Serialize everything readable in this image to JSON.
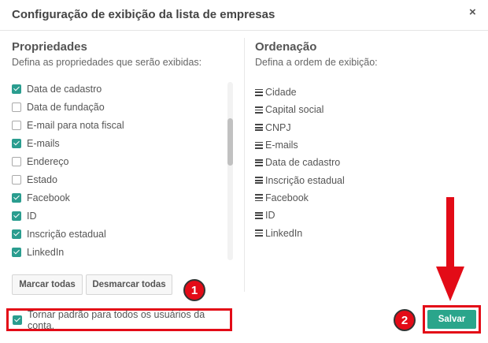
{
  "dialog": {
    "title": "Configuração de exibição da lista de empresas",
    "close_icon": "×"
  },
  "properties": {
    "heading": "Propriedades",
    "subtitle": "Defina as propriedades que serão exibidas:",
    "items": [
      {
        "label": "Data de cadastro",
        "checked": true
      },
      {
        "label": "Data de fundação",
        "checked": false
      },
      {
        "label": "E-mail para nota fiscal",
        "checked": false
      },
      {
        "label": "E-mails",
        "checked": true
      },
      {
        "label": "Endereço",
        "checked": false
      },
      {
        "label": "Estado",
        "checked": false
      },
      {
        "label": "Facebook",
        "checked": true
      },
      {
        "label": "ID",
        "checked": true
      },
      {
        "label": "Inscrição estadual",
        "checked": true
      },
      {
        "label": "LinkedIn",
        "checked": true
      }
    ],
    "select_all_label": "Marcar todas",
    "deselect_all_label": "Desmarcar todas"
  },
  "ordering": {
    "heading": "Ordenação",
    "subtitle": "Defina a ordem de exibição:",
    "items": [
      "Cidade",
      "Capital social",
      "CNPJ",
      "E-mails",
      "Data de cadastro",
      "Inscrição estadual",
      "Facebook",
      "ID",
      "LinkedIn"
    ]
  },
  "footer": {
    "default_label": "Tornar padrão para todos os usuários da conta.",
    "default_checked": true,
    "save_label": "Salvar"
  },
  "annotations": {
    "badge_1": "1",
    "badge_2": "2",
    "highlight_color": "#e30b17",
    "arrow_color": "#e30b17"
  },
  "colors": {
    "accent": "#2aa58b",
    "checkbox": "#2a9d8f"
  }
}
